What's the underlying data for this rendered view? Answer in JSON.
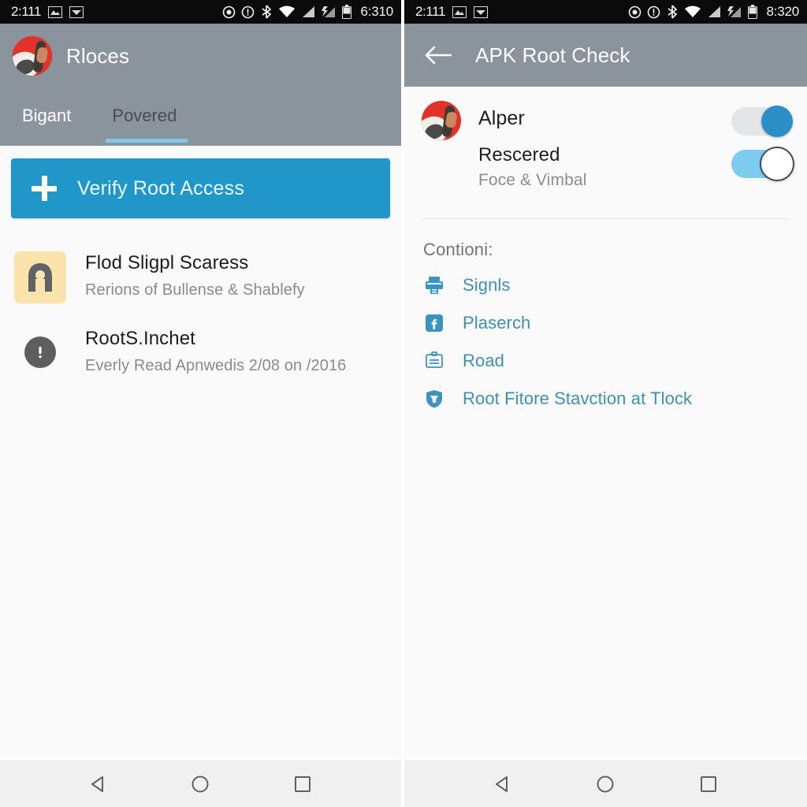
{
  "left": {
    "status_bar": {
      "clock_left": "2:111",
      "time": "6:310",
      "icons_left": [
        "image-icon",
        "image-icon"
      ],
      "icons_right": [
        "location-icon",
        "alert-circle-icon",
        "bluetooth-icon",
        "wifi-icon",
        "signal-icon",
        "signal-alt-icon",
        "battery-icon"
      ]
    },
    "appbar": {
      "title": "Rloces",
      "avatar_name": "avatar"
    },
    "tabs": [
      {
        "label": "Bigant",
        "active": false
      },
      {
        "label": "Povered",
        "active": true
      }
    ],
    "cta": {
      "label": "Verify Root Access",
      "icon": "plus-icon",
      "color": "#2196c8"
    },
    "list": [
      {
        "icon": "arch-app-icon",
        "icon_bg": "#fbe3ab",
        "title": "Flod Sligpl Scaress",
        "subtitle": "Rerions of Bullense & Shablefy"
      },
      {
        "icon": "alert-circle-icon",
        "icon_bg": "#5e5e5e",
        "title": "RootS.Inchet",
        "subtitle": "Everly Read Apnwedis 2/08 on /2016"
      }
    ],
    "navbar": [
      "back-triangle-icon",
      "home-circle-icon",
      "recents-square-icon"
    ]
  },
  "right": {
    "status_bar": {
      "clock_left": "2:111",
      "time": "8:320",
      "icons_left": [
        "image-icon",
        "image-icon"
      ],
      "icons_right": [
        "location-icon",
        "alert-circle-icon",
        "bluetooth-icon",
        "wifi-icon",
        "signal-icon",
        "signal-alt-icon",
        "battery-icon"
      ]
    },
    "appbar": {
      "back_icon": "back-arrow-icon",
      "title": "APK Root Check"
    },
    "profile": {
      "name": "Alper",
      "sub_title": "Rescered",
      "sub_caption": "Foce & Vimbal",
      "toggle_one": {
        "state": "on",
        "track_color": "#e3e5e7",
        "thumb_color": "#2a8fc4"
      },
      "toggle_two": {
        "state": "on",
        "track_color": "#7ecbf0",
        "thumb_color": "#ffffff"
      }
    },
    "section_label": "Contioni:",
    "links": [
      {
        "icon": "printer-icon",
        "label": "Signls"
      },
      {
        "icon": "facebook-icon",
        "label": "Plaserch"
      },
      {
        "icon": "clipboard-icon",
        "label": "Road"
      },
      {
        "icon": "shield-icon",
        "label": "Root Fitore Stavction at Tlock"
      }
    ],
    "navbar": [
      "back-triangle-icon",
      "home-circle-icon",
      "recents-square-icon"
    ]
  }
}
